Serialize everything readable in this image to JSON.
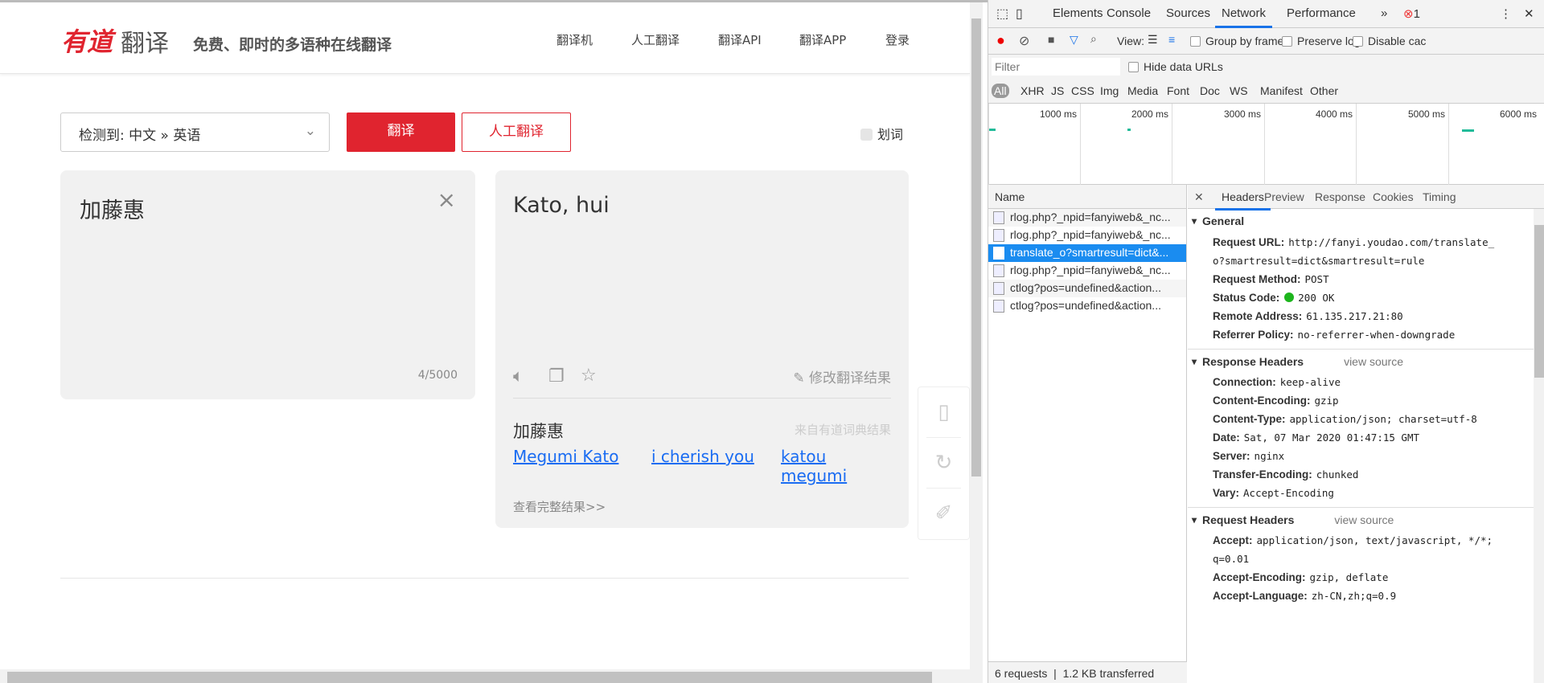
{
  "page": {
    "logo": {
      "brand": "有道",
      "product": "翻译"
    },
    "slogan": "免费、即时的多语种在线翻译",
    "nav": [
      "翻译机",
      "人工翻译",
      "翻译API",
      "翻译APP",
      "登录"
    ],
    "lang_select": "检测到: 中文 » 英语",
    "translate_button": "翻译",
    "human_button": "人工翻译",
    "select_word": "划词",
    "input": {
      "text": "加藤惠",
      "count": "4/5000",
      "clear": "×"
    },
    "output": {
      "text": "Kato, hui",
      "edit_label": "修改翻译结果",
      "dict_word": "加藤惠",
      "dict_source": "来自有道词典结果",
      "links": [
        "Megumi Kato",
        "i cherish you",
        "katou megumi"
      ],
      "more": "查看完整结果>>"
    }
  },
  "devtools": {
    "tabs": [
      "Elements",
      "Console",
      "Sources",
      "Network",
      "Performance"
    ],
    "active_tab": "Network",
    "error_count": "1",
    "toolbar": {
      "view_label": "View:",
      "group_by_frame": "Group by frame",
      "preserve_log": "Preserve log",
      "disable_cache": "Disable cac"
    },
    "filter_placeholder": "Filter",
    "hide_data_urls": "Hide data URLs",
    "types": [
      "All",
      "XHR",
      "JS",
      "CSS",
      "Img",
      "Media",
      "Font",
      "Doc",
      "WS",
      "Manifest",
      "Other"
    ],
    "timeline_ticks": [
      "1000 ms",
      "2000 ms",
      "3000 ms",
      "4000 ms",
      "5000 ms",
      "6000 ms"
    ],
    "name_header": "Name",
    "requests": [
      "rlog.php?_npid=fanyiweb&_nc...",
      "rlog.php?_npid=fanyiweb&_nc...",
      "translate_o?smartresult=dict&...",
      "rlog.php?_npid=fanyiweb&_nc...",
      "ctlog?pos=undefined&action...",
      "ctlog?pos=undefined&action..."
    ],
    "footer": {
      "requests": "6 requests",
      "transferred": "1.2 KB transferred"
    },
    "detail_tabs": [
      "Headers",
      "Preview",
      "Response",
      "Cookies",
      "Timing"
    ],
    "general": {
      "title": "General",
      "items": [
        {
          "k": "Request URL:",
          "v": "http://fanyi.youdao.com/translate_"
        },
        {
          "k": "",
          "v": "o?smartresult=dict&smartresult=rule"
        },
        {
          "k": "Request Method:",
          "v": "POST"
        },
        {
          "k": "Status Code:",
          "v": "200 OK"
        },
        {
          "k": "Remote Address:",
          "v": "61.135.217.21:80"
        },
        {
          "k": "Referrer Policy:",
          "v": "no-referrer-when-downgrade"
        }
      ]
    },
    "response_headers": {
      "title": "Response Headers",
      "view_source": "view source",
      "items": [
        {
          "k": "Connection:",
          "v": "keep-alive"
        },
        {
          "k": "Content-Encoding:",
          "v": "gzip"
        },
        {
          "k": "Content-Type:",
          "v": "application/json; charset=utf-8"
        },
        {
          "k": "Date:",
          "v": "Sat, 07 Mar 2020 01:47:15 GMT"
        },
        {
          "k": "Server:",
          "v": "nginx"
        },
        {
          "k": "Transfer-Encoding:",
          "v": "chunked"
        },
        {
          "k": "Vary:",
          "v": "Accept-Encoding"
        }
      ]
    },
    "request_headers": {
      "title": "Request Headers",
      "view_source": "view source",
      "items": [
        {
          "k": "Accept:",
          "v": "application/json, text/javascript, */*;"
        },
        {
          "k": "",
          "v": "q=0.01"
        },
        {
          "k": "Accept-Encoding:",
          "v": "gzip, deflate"
        },
        {
          "k": "Accept-Language:",
          "v": "zh-CN,zh;q=0.9"
        }
      ]
    }
  }
}
